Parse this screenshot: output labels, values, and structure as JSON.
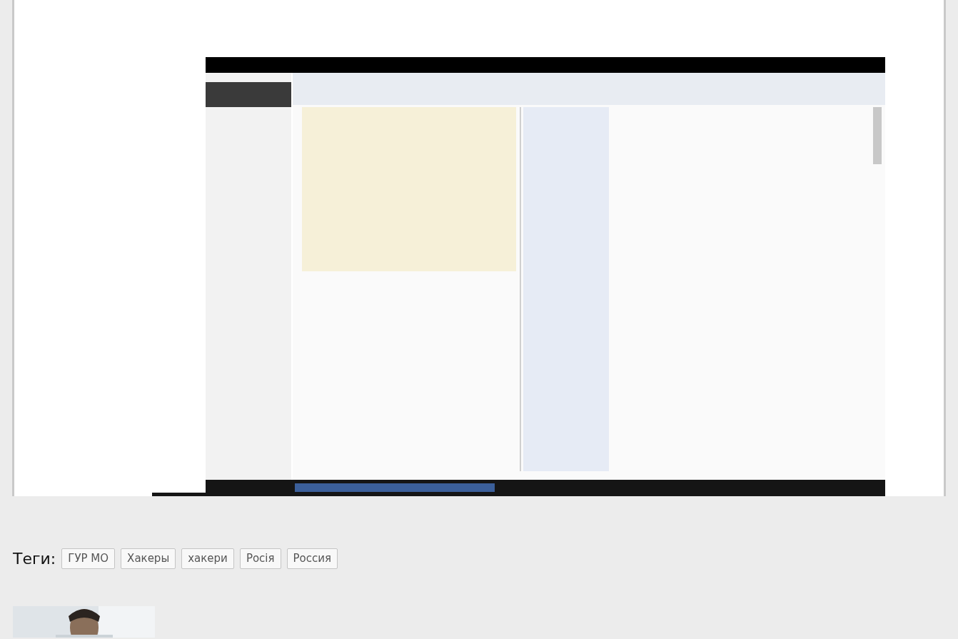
{
  "tags": {
    "label": "Теги:",
    "items": [
      "ГУР МО",
      "Хакеры",
      "хакери",
      "Росія",
      "Россия"
    ]
  }
}
